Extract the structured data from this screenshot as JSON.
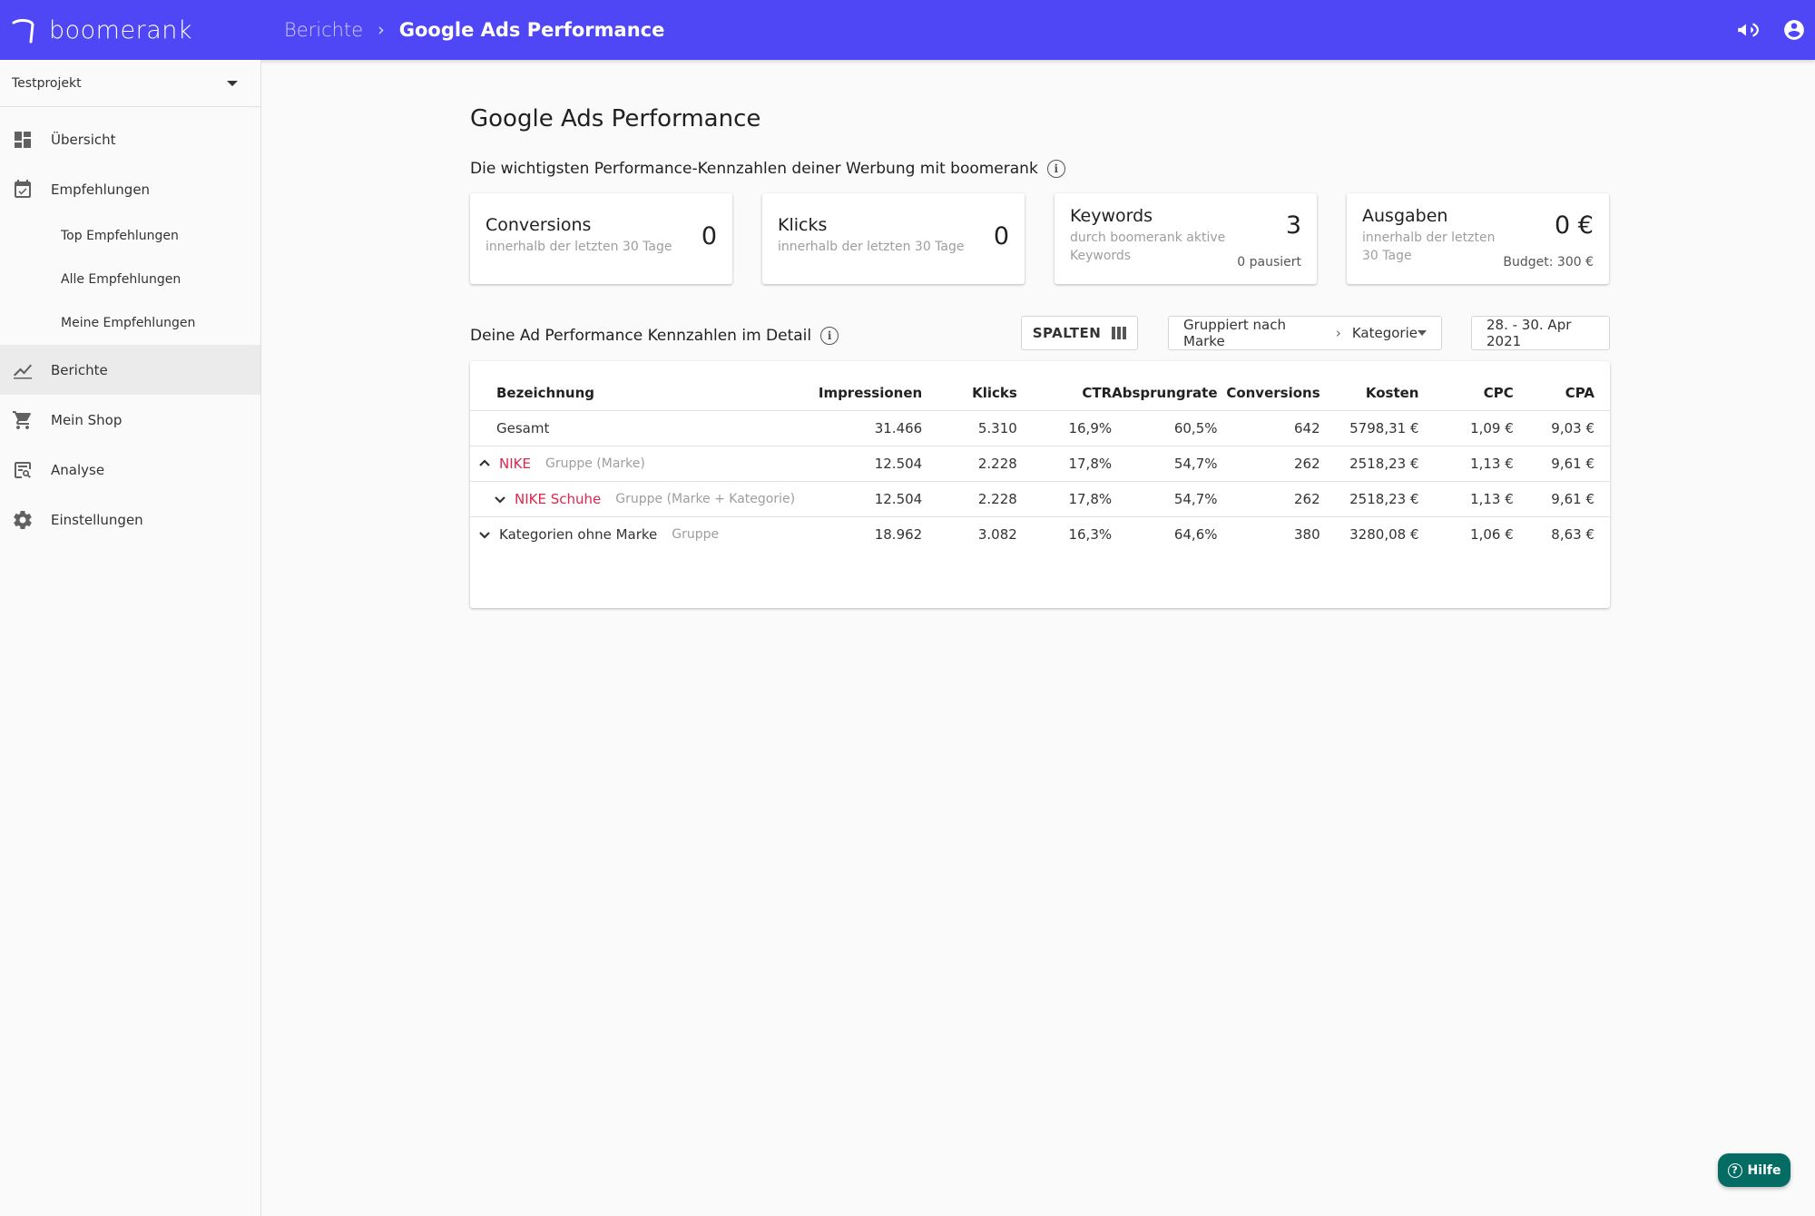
{
  "app": {
    "logo_text": "boomerank",
    "breadcrumb_parent": "Berichte",
    "breadcrumb_separator": "›",
    "breadcrumb_current": "Google Ads Performance",
    "brand_color": "#4f46f5"
  },
  "sidebar": {
    "project": "Testprojekt",
    "items": [
      {
        "label": "Übersicht",
        "icon": "dashboard-icon"
      },
      {
        "label": "Empfehlungen",
        "icon": "calendar-check-icon"
      },
      {
        "label": "Top Empfehlungen",
        "sub": true
      },
      {
        "label": "Alle Empfehlungen",
        "sub": true
      },
      {
        "label": "Meine Empfehlungen",
        "sub": true
      },
      {
        "label": "Berichte",
        "icon": "chart-line-icon",
        "active": true
      },
      {
        "label": "Mein Shop",
        "icon": "cart-icon"
      },
      {
        "label": "Analyse",
        "icon": "analysis-icon"
      },
      {
        "label": "Einstellungen",
        "icon": "gear-icon"
      }
    ]
  },
  "main": {
    "title": "Google Ads Performance",
    "kpi_section_title": "Die wichtigsten Performance-Kennzahlen deiner Werbung mit boomerank",
    "cards": [
      {
        "title": "Conversions",
        "sub": "innerhalb der letzten 30 Tage",
        "value": "0"
      },
      {
        "title": "Klicks",
        "sub": "innerhalb der letzten 30 Tage",
        "value": "0"
      },
      {
        "title": "Keywords",
        "sub": "durch boomerank aktive Keywords",
        "value": "3",
        "note": "0 pausiert"
      },
      {
        "title": "Ausgaben",
        "sub": "innerhalb der letzten 30 Tage",
        "value": "0 €",
        "note": "Budget: 300 €"
      }
    ],
    "detail_section_title": "Deine Ad Performance Kennzahlen im Detail",
    "columns_button": "SPALTEN",
    "grouping": {
      "prefix": "Gruppiert nach Marke",
      "separator": "›",
      "value": "Kategorie"
    },
    "date_range": "28. - 30. Apr 2021"
  },
  "table": {
    "headers": [
      "Bezeichnung",
      "Impressionen",
      "Klicks",
      "CTR",
      "Absprungrate",
      "Conversions",
      "Kosten",
      "CPC",
      "CPA"
    ],
    "rows": [
      {
        "name": "Gesamt",
        "tag": "",
        "chevron": "",
        "red": false,
        "indent": 0,
        "values": [
          "31.466",
          "5.310",
          "16,9%",
          "60,5%",
          "642",
          "5798,31 €",
          "1,09 €",
          "9,03 €"
        ]
      },
      {
        "name": "NIKE",
        "tag": "Gruppe (Marke)",
        "chevron": "up",
        "red": true,
        "indent": 0,
        "values": [
          "12.504",
          "2.228",
          "17,8%",
          "54,7%",
          "262",
          "2518,23 €",
          "1,13 €",
          "9,61 €"
        ]
      },
      {
        "name": "NIKE Schuhe",
        "tag": "Gruppe (Marke + Kategorie)",
        "chevron": "down",
        "red": true,
        "indent": 1,
        "values": [
          "12.504",
          "2.228",
          "17,8%",
          "54,7%",
          "262",
          "2518,23 €",
          "1,13 €",
          "9,61 €"
        ]
      },
      {
        "name": "Kategorien ohne Marke",
        "tag": "Gruppe",
        "chevron": "down",
        "red": false,
        "indent": 0,
        "values": [
          "18.962",
          "3.082",
          "16,3%",
          "64,6%",
          "380",
          "3280,08 €",
          "1,06 €",
          "8,63 €"
        ]
      }
    ]
  },
  "help_button": "Hilfe"
}
